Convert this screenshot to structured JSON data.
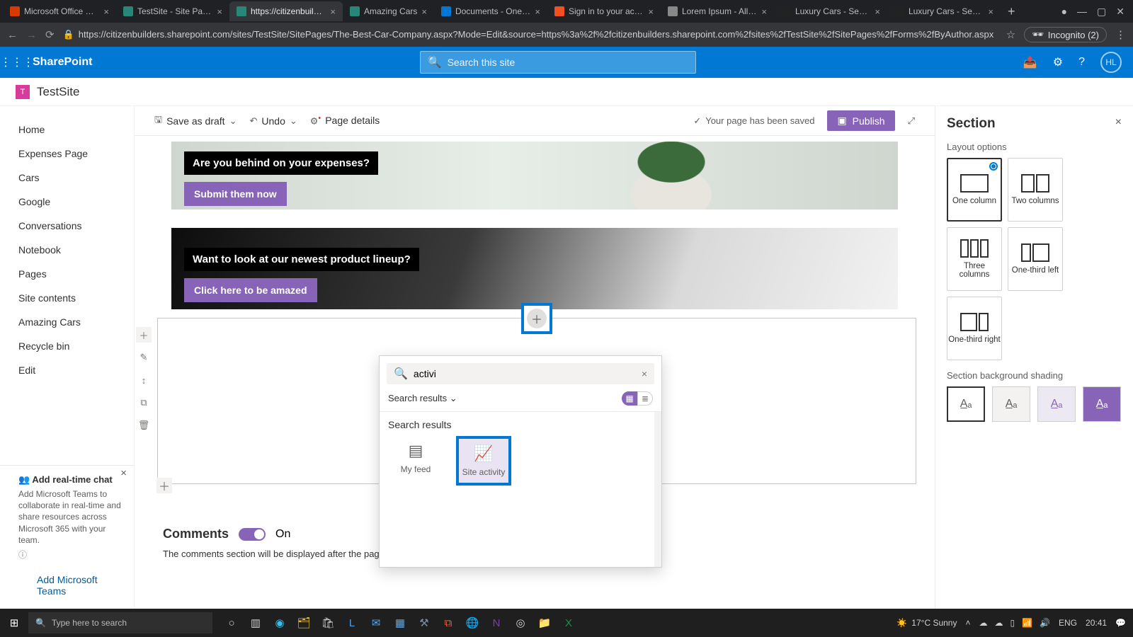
{
  "browser": {
    "tabs": [
      {
        "title": "Microsoft Office Home",
        "fav": "#d83b01"
      },
      {
        "title": "TestSite - Site Pages -",
        "fav": "#27887a"
      },
      {
        "title": "https://citizenbuilders",
        "fav": "#27887a",
        "active": true
      },
      {
        "title": "Amazing Cars",
        "fav": "#27887a"
      },
      {
        "title": "Documents - OneDri",
        "fav": "#0078d4"
      },
      {
        "title": "Sign in to your accou",
        "fav": "#f25022"
      },
      {
        "title": "Lorem Ipsum - All the",
        "fav": "#888"
      },
      {
        "title": "Luxury Cars - Sedans,",
        "fav": "#222"
      },
      {
        "title": "Luxury Cars - Sedans,",
        "fav": "#222"
      }
    ],
    "url": "https://citizenbuilders.sharepoint.com/sites/TestSite/SitePages/The-Best-Car-Company.aspx?Mode=Edit&source=https%3a%2f%2fcitizenbuilders.sharepoint.com%2fsites%2fTestSite%2fSitePages%2fForms%2fByAuthor.aspx",
    "incognito": "Incognito (2)"
  },
  "suite": {
    "brand": "SharePoint",
    "search_placeholder": "Search this site",
    "avatar": "HL"
  },
  "site": {
    "logo_initial": "T",
    "name": "TestSite"
  },
  "leftnav": {
    "items": [
      "Home",
      "Expenses Page",
      "Cars",
      "Google",
      "Conversations",
      "Notebook",
      "Pages",
      "Site contents",
      "Amazing Cars",
      "Recycle bin",
      "Edit"
    ]
  },
  "teamspromo": {
    "title": "Add real-time chat",
    "desc": "Add Microsoft Teams to collaborate in real-time and share resources across Microsoft 365 with your team.",
    "link": "Add Microsoft Teams"
  },
  "cmdbar": {
    "save": "Save as draft",
    "undo": "Undo",
    "details": "Page details",
    "saved": "Your page has been saved",
    "publish": "Publish"
  },
  "heroes": {
    "a_label": "Are you behind on your expenses?",
    "a_btn": "Submit them now",
    "b_label": "Want to look at our newest product lineup?",
    "b_btn": "Click here to be amazed"
  },
  "webpartpicker": {
    "search_value": "activi",
    "dropdown": "Search results",
    "section_header": "Search results",
    "tiles": [
      {
        "label": "My feed"
      },
      {
        "label": "Site activity",
        "selected": true
      }
    ]
  },
  "comments": {
    "heading": "Comments",
    "state": "On",
    "note": "The comments section will be displayed after the page is published."
  },
  "proppane": {
    "title": "Section",
    "layout_heading": "Layout options",
    "layouts": [
      {
        "label": "One column",
        "selected": true
      },
      {
        "label": "Two columns"
      },
      {
        "label": "Three columns"
      },
      {
        "label": "One-third left"
      },
      {
        "label": "One-third right"
      }
    ],
    "shade_heading": "Section background shading"
  },
  "taskbar": {
    "search_placeholder": "Type here to search",
    "weather": "17°C  Sunny",
    "lang": "ENG",
    "time": "20:41"
  }
}
